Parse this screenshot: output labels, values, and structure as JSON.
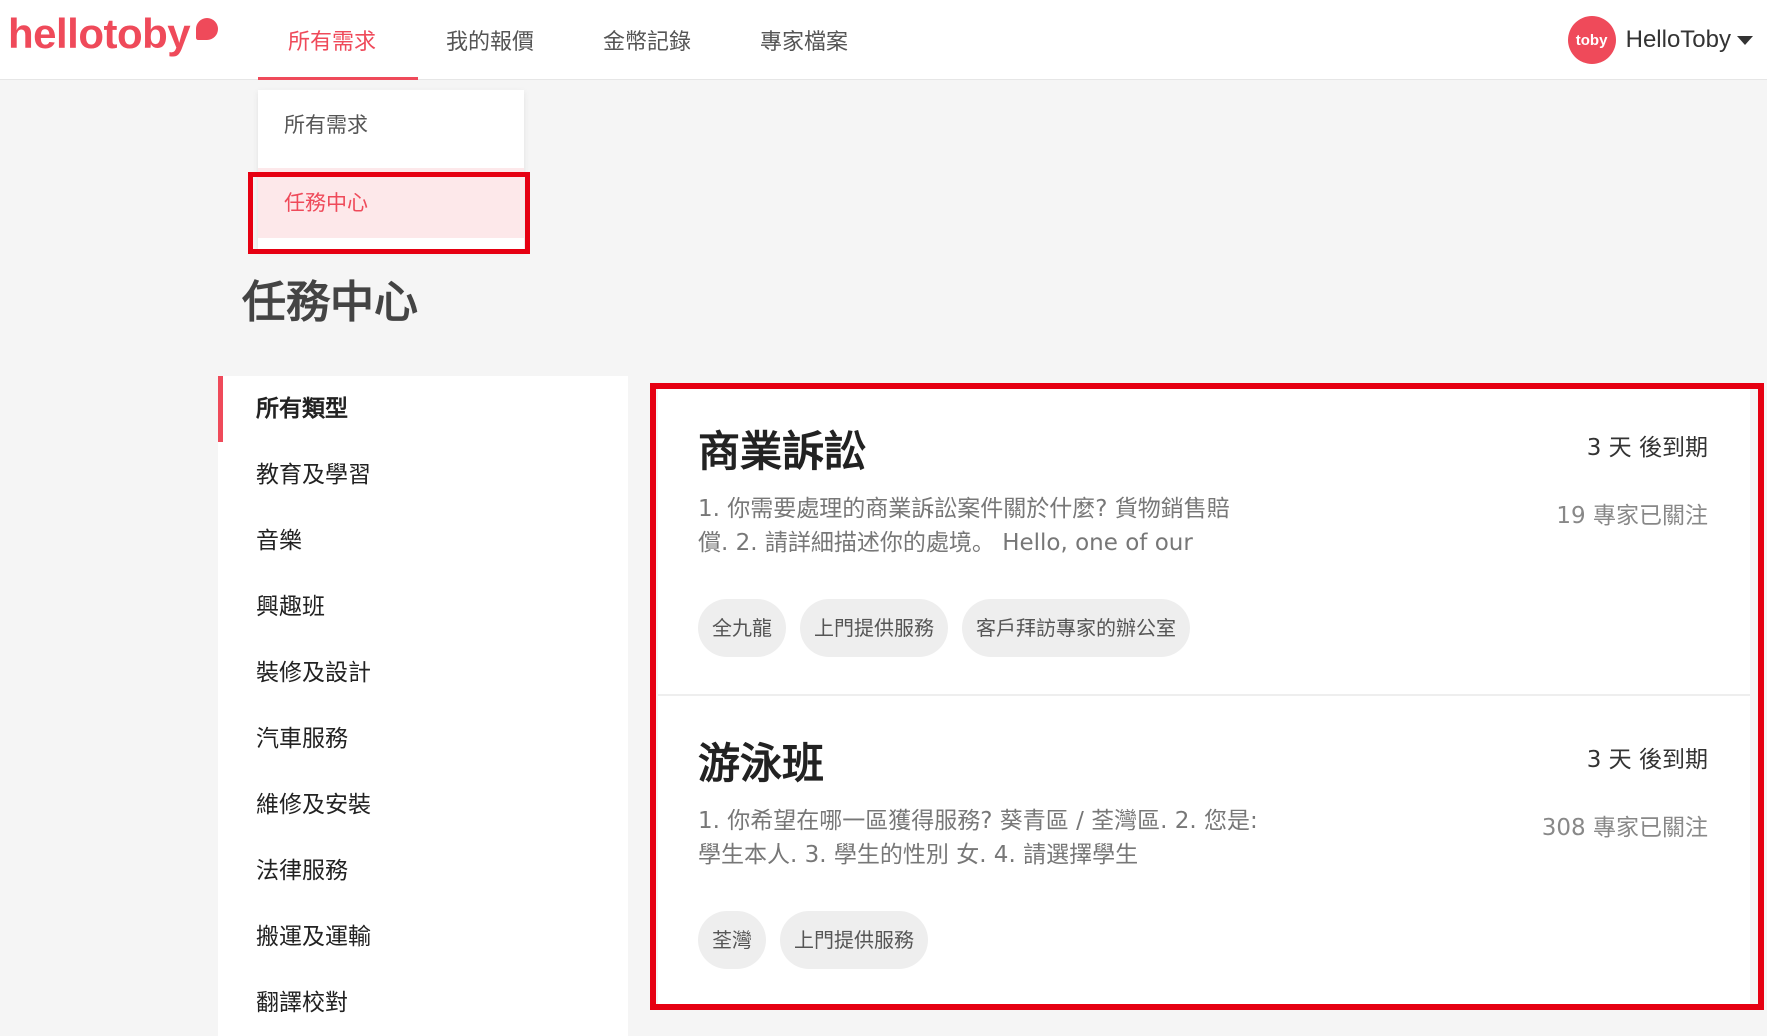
{
  "header": {
    "logo": "hellotoby",
    "nav": [
      {
        "label": "所有需求"
      },
      {
        "label": "我的報價"
      },
      {
        "label": "金幣記錄"
      },
      {
        "label": "專家檔案"
      }
    ],
    "user": {
      "avatar_text": "toby",
      "name": "HelloToby"
    }
  },
  "dropdown": {
    "items": [
      {
        "label": "所有需求"
      },
      {
        "label": "任務中心"
      }
    ]
  },
  "page_title": "任務中心",
  "categories": [
    "所有類型",
    "教育及學習",
    "音樂",
    "興趣班",
    "裝修及設計",
    "汽車服務",
    "維修及安裝",
    "法律服務",
    "搬運及運輸",
    "翻譯校對"
  ],
  "tasks": [
    {
      "title": "商業訴訟",
      "expiry": "3 天 後到期",
      "followers": "19 專家已關注",
      "description": "1. 你需要處理的商業訴訟案件關於什麼? 貨物銷售賠償. 2. 請詳細描述你的處境。 Hello, one of our",
      "tags": [
        "全九龍",
        "上門提供服務",
        "客戶拜訪專家的辦公室"
      ]
    },
    {
      "title": "游泳班",
      "expiry": "3 天 後到期",
      "followers": "308 專家已關注",
      "description": "1. 你希望在哪一區獲得服務? 葵青區 / 荃灣區. 2. 您是: 學生本人. 3. 學生的性別 女. 4. 請選擇學生",
      "tags": [
        "荃灣",
        "上門提供服務"
      ]
    }
  ],
  "colors": {
    "brand": "#ef4a5a",
    "highlight": "#e60012"
  }
}
